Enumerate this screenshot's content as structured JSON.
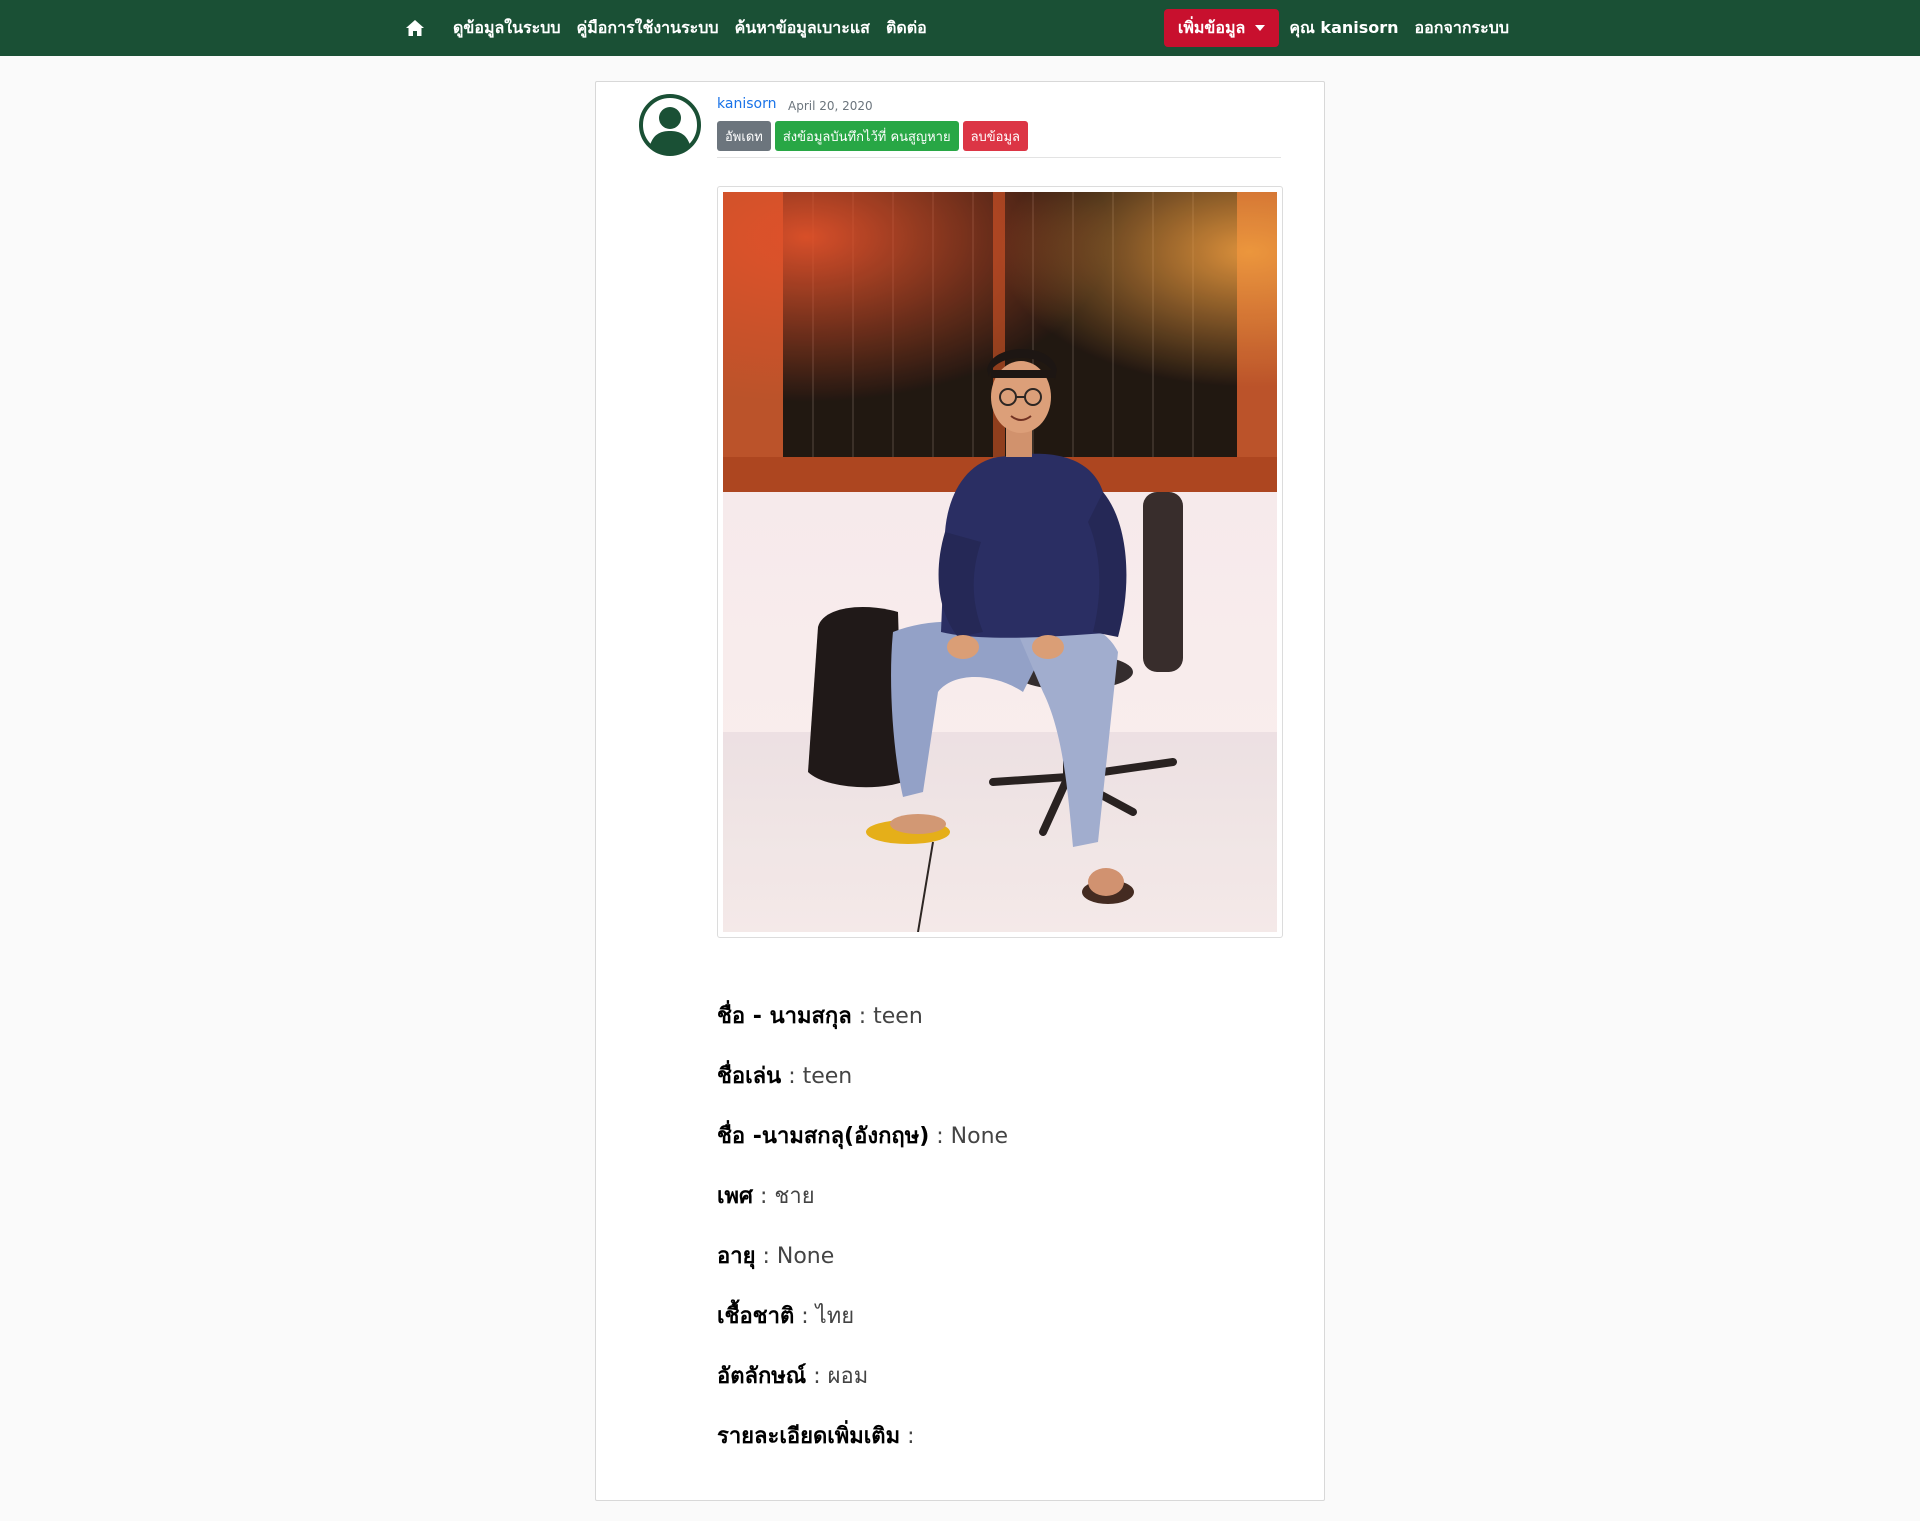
{
  "navbar": {
    "links": [
      "ดูข้อมูลในระบบ",
      "คู่มือการใช้งานระบบ",
      "ค้นหาข้อมูลเบาะแส",
      "ติดต่อ"
    ],
    "add_button": "เพิ่มข้อมูล",
    "user_label": "คุณ kanisorn",
    "logout_label": "ออกจากระบบ",
    "colors": {
      "background": "#1a5035",
      "add_button": "#c8102e"
    }
  },
  "post": {
    "author": "kanisorn",
    "date": "April 20, 2020",
    "actions": {
      "update": "อัพเดท",
      "send": "ส่งข้อมูลบันทึกไว้ที่ คนสูญหาย",
      "delete": "ลบข้อมูล"
    },
    "fields": [
      {
        "label": "ชื่อ - นามสกุล",
        "value": "teen"
      },
      {
        "label": "ชื่อเล่น",
        "value": "teen"
      },
      {
        "label": "ชื่อ -นามสกลุ(อังกฤษ)",
        "value": "None"
      },
      {
        "label": "เพศ",
        "value": "ชาย"
      },
      {
        "label": "อายุ",
        "value": "None"
      },
      {
        "label": "เชื้อชาติ",
        "value": "ไทย"
      },
      {
        "label": "อัตลักษณ์",
        "value": "ผอม"
      },
      {
        "label": "รายละเอียดเพิ่มเติม",
        "value": ""
      }
    ],
    "separator": ":"
  }
}
